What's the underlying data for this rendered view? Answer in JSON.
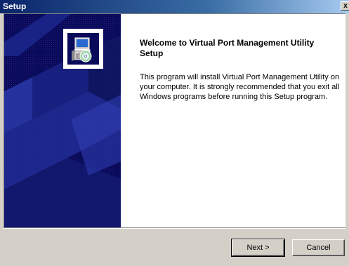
{
  "window": {
    "title": "Setup",
    "close_label": "x"
  },
  "welcome": {
    "heading": "Welcome to Virtual Port Management Utility Setup",
    "body": "This program will install Virtual Port Management Utility on your computer.  It is strongly recommended that you exit all Windows programs before running this Setup program."
  },
  "buttons": {
    "next": "Next >",
    "cancel": "Cancel"
  },
  "colors": {
    "titlebar": "#0a246a",
    "side_panel": "#0a0a5a",
    "face": "#d4d0c8"
  },
  "icons": {
    "installer": "setup-computer-cd-icon"
  }
}
